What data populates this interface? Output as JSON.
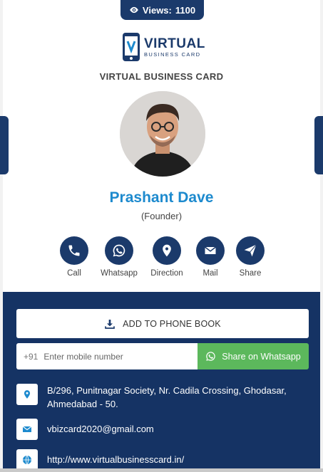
{
  "header": {
    "views_label": "Views:",
    "views_count": "1100"
  },
  "logo": {
    "main": "VIRTUAL",
    "sub": "BUSINESS CARD"
  },
  "subtitle": "VIRTUAL BUSINESS CARD",
  "profile": {
    "name": "Prashant Dave",
    "role": "(Founder)"
  },
  "actions": [
    {
      "label": "Call",
      "icon": "phone-icon"
    },
    {
      "label": "Whatsapp",
      "icon": "whatsapp-icon"
    },
    {
      "label": "Direction",
      "icon": "map-pin-icon"
    },
    {
      "label": "Mail",
      "icon": "mail-icon"
    },
    {
      "label": "Share",
      "icon": "send-icon"
    }
  ],
  "panel": {
    "add_label": "ADD TO PHONE BOOK",
    "phone_code": "+91",
    "phone_placeholder": "Enter mobile number",
    "share_label": "Share on Whatsapp",
    "address": "B/296, Punitnagar Society, Nr. Cadila Crossing, Ghodasar, Ahmedabad - 50.",
    "email": "vbizcard2020@gmail.com",
    "website": "http://www.virtualbusinesscard.in/"
  },
  "colors": {
    "primary": "#1b3a6b",
    "accent": "#1d8ace",
    "whatsapp": "#5cb85c",
    "panel": "#153364"
  }
}
